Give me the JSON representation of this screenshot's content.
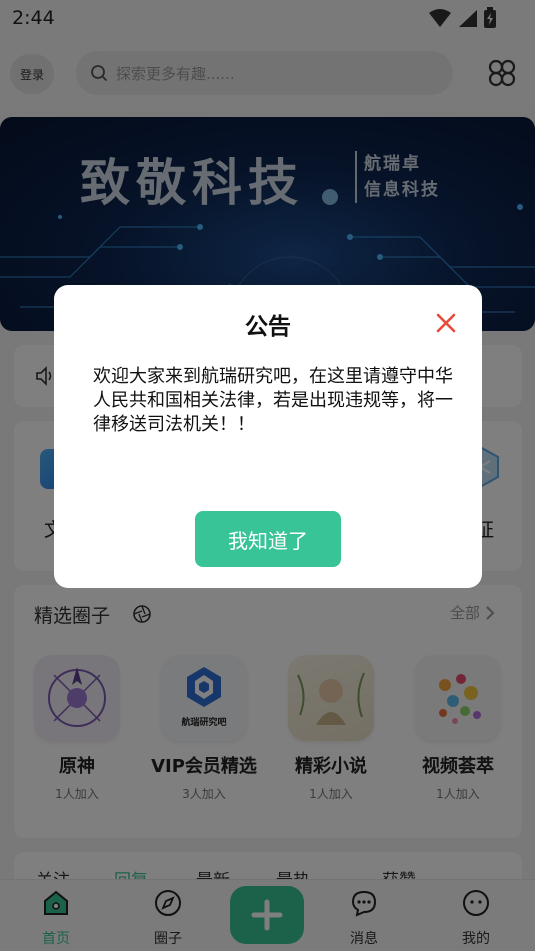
{
  "status_bar": {
    "time": "2:44"
  },
  "header": {
    "login_label": "登录",
    "search_placeholder": "探索更多有趣......"
  },
  "banner": {
    "title": "致敬科技",
    "subtitle_line1": "航瑞卓",
    "subtitle_line2": "信息科技"
  },
  "features": {
    "left_label": "文",
    "right_label": "证"
  },
  "circles": {
    "title": "精选圈子",
    "more_label": "全部",
    "items": [
      {
        "name": "原神",
        "count": "1人加入"
      },
      {
        "name": "VIP会员精选",
        "count": "3人加入",
        "thumb_text": "航瑞研究吧"
      },
      {
        "name": "精彩小说",
        "count": "1人加入"
      },
      {
        "name": "视频荟萃",
        "count": "1人加入"
      }
    ]
  },
  "tabs": [
    "关注",
    "回复",
    "最新",
    "最热",
    "获赞"
  ],
  "bottom_nav": {
    "home": "首页",
    "circle": "圈子",
    "messages": "消息",
    "mine": "我的"
  },
  "dialog": {
    "title": "公告",
    "body": "欢迎大家来到航瑞研究吧，在这里请遵守中华人民共和国相关法律，若是出现违规等，将一律移送司法机关！！",
    "button_label": "我知道了"
  },
  "colors": {
    "accent": "#38c497",
    "close": "#e84a3a"
  }
}
